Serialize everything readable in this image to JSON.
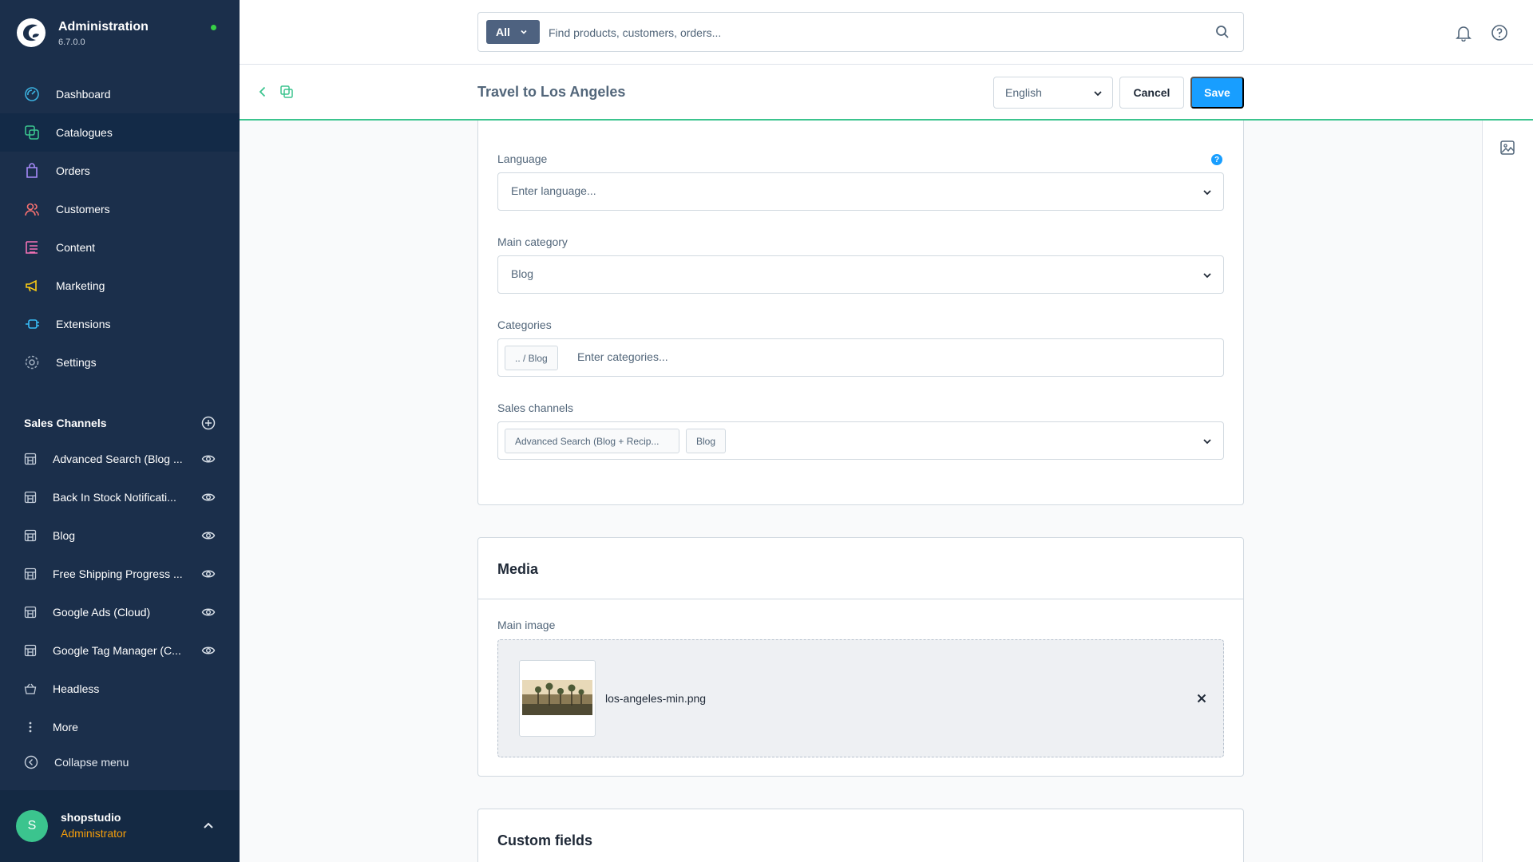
{
  "app": {
    "name": "Administration",
    "version": "6.7.0.0"
  },
  "nav": {
    "items": [
      {
        "label": "Dashboard",
        "icon": "dashboard-icon"
      },
      {
        "label": "Catalogues",
        "icon": "catalogues-icon"
      },
      {
        "label": "Orders",
        "icon": "orders-icon"
      },
      {
        "label": "Customers",
        "icon": "customers-icon"
      },
      {
        "label": "Content",
        "icon": "content-icon"
      },
      {
        "label": "Marketing",
        "icon": "marketing-icon"
      },
      {
        "label": "Extensions",
        "icon": "extensions-icon"
      },
      {
        "label": "Settings",
        "icon": "settings-icon"
      }
    ],
    "active": "Catalogues"
  },
  "sales_channels": {
    "title": "Sales Channels",
    "items": [
      {
        "label": "Advanced Search (Blog ..."
      },
      {
        "label": "Back In Stock Notificati..."
      },
      {
        "label": "Blog"
      },
      {
        "label": "Free Shipping Progress ..."
      },
      {
        "label": "Google Ads (Cloud)"
      },
      {
        "label": "Google Tag Manager (C..."
      },
      {
        "label": "Headless"
      }
    ],
    "more_label": "More",
    "collapse_label": "Collapse menu"
  },
  "user": {
    "initial": "S",
    "name": "shopstudio",
    "role": "Administrator"
  },
  "search": {
    "type_label": "All",
    "placeholder": "Find products, customers, orders..."
  },
  "smartbar": {
    "title": "Travel to Los Angeles",
    "language": "English",
    "cancel_label": "Cancel",
    "save_label": "Save"
  },
  "form": {
    "language": {
      "label": "Language",
      "placeholder": "Enter language...",
      "help": "?"
    },
    "main_category": {
      "label": "Main category",
      "value": "Blog"
    },
    "categories": {
      "label": "Categories",
      "tags": [
        ".. / Blog"
      ],
      "placeholder": "Enter categories..."
    },
    "sales_channels": {
      "label": "Sales channels",
      "tags": [
        "Advanced Search (Blog + Recip...",
        "Blog"
      ]
    }
  },
  "media": {
    "heading": "Media",
    "main_image_label": "Main image",
    "file_name": "los-angeles-min.png"
  },
  "custom_fields": {
    "heading": "Custom fields"
  },
  "colors": {
    "sidebar": "#1b2f4b",
    "accent": "#189eff",
    "success": "#3bc48e",
    "role": "#f59e0b"
  }
}
